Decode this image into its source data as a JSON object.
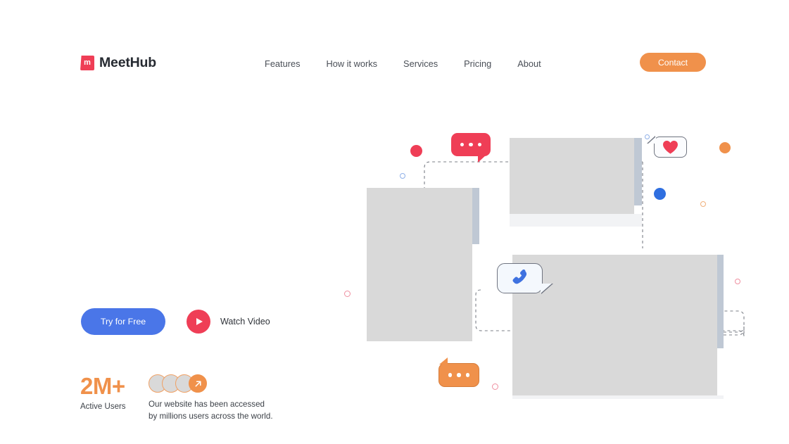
{
  "brand": {
    "logo_letter": "m",
    "name": "MeetHub",
    "logo_color": "#ef3e56",
    "text_color": "#262a31"
  },
  "nav": {
    "items": [
      {
        "label": "Features"
      },
      {
        "label": "How it works"
      },
      {
        "label": "Services"
      },
      {
        "label": "Pricing"
      },
      {
        "label": "About"
      }
    ],
    "contact_label": "Contact",
    "contact_color": "#f0914b"
  },
  "hero": {
    "primary_cta": "Try for Free",
    "primary_cta_color": "#4a76e8",
    "video_label": "Watch Video",
    "play_color": "#ef3e56"
  },
  "stats": {
    "number": "2M+",
    "number_color": "#f0914b",
    "label": "Active Users",
    "description": "Our website has been accessed\nby millions users across the world.",
    "avatar_count": 4,
    "avatar_accent": "#f0914b"
  },
  "illustration": {
    "bubbles": [
      {
        "name": "typing-red",
        "type": "dots",
        "color": "#ef3e56",
        "dots": 3
      },
      {
        "name": "reaction-heart",
        "type": "heart",
        "color": "#ef3e56"
      },
      {
        "name": "call-phone",
        "type": "phone",
        "color": "#4a76e8"
      },
      {
        "name": "typing-orange",
        "type": "dots",
        "color": "#f0914b",
        "dots": 3
      }
    ],
    "accent_dots": [
      {
        "name": "dot-red-filled",
        "color": "#ef3e56"
      },
      {
        "name": "dot-blue-ring",
        "color": "#6f9fe8"
      },
      {
        "name": "dot-orange-filled",
        "color": "#f0914b"
      },
      {
        "name": "dot-blue-filled",
        "color": "#2f6fe0"
      },
      {
        "name": "dot-red-ring",
        "color": "#ef8fa0"
      },
      {
        "name": "dot-orange-ring",
        "color": "#f0b07b"
      }
    ]
  }
}
